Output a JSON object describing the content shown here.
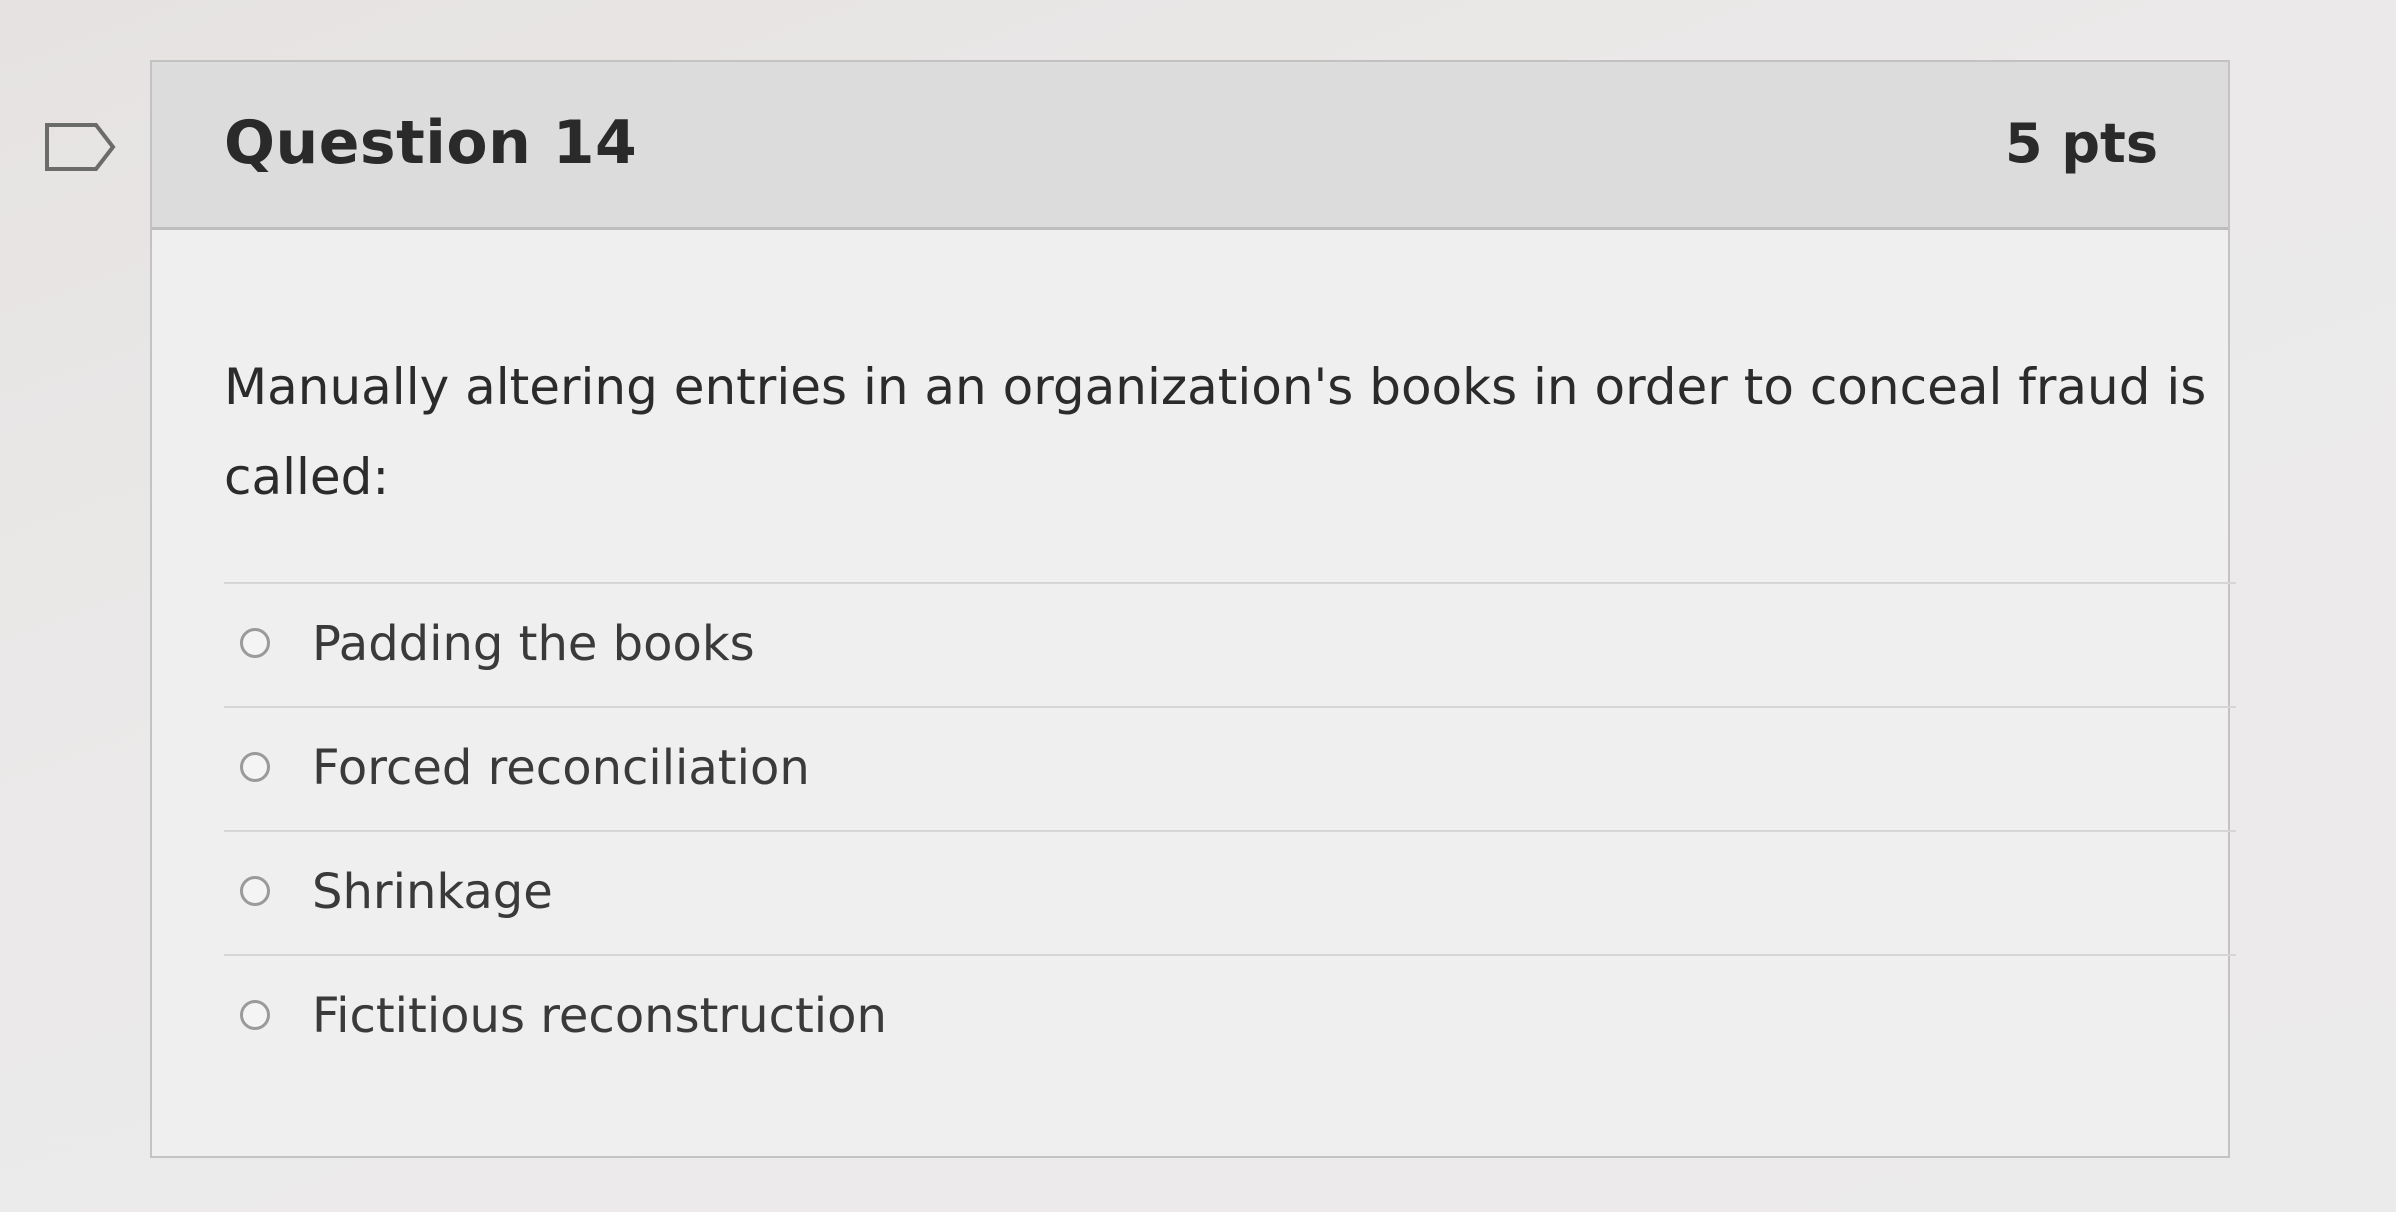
{
  "question": {
    "title": "Question 14",
    "points": "5 pts",
    "text": "Manually altering entries in an organization's books in order to conceal fraud is called:",
    "answers": [
      {
        "label": "Padding the books"
      },
      {
        "label": "Forced reconciliation"
      },
      {
        "label": "Shrinkage"
      },
      {
        "label": "Fictitious reconstruction"
      }
    ]
  },
  "icons": {
    "flag": "flag-question-icon"
  }
}
